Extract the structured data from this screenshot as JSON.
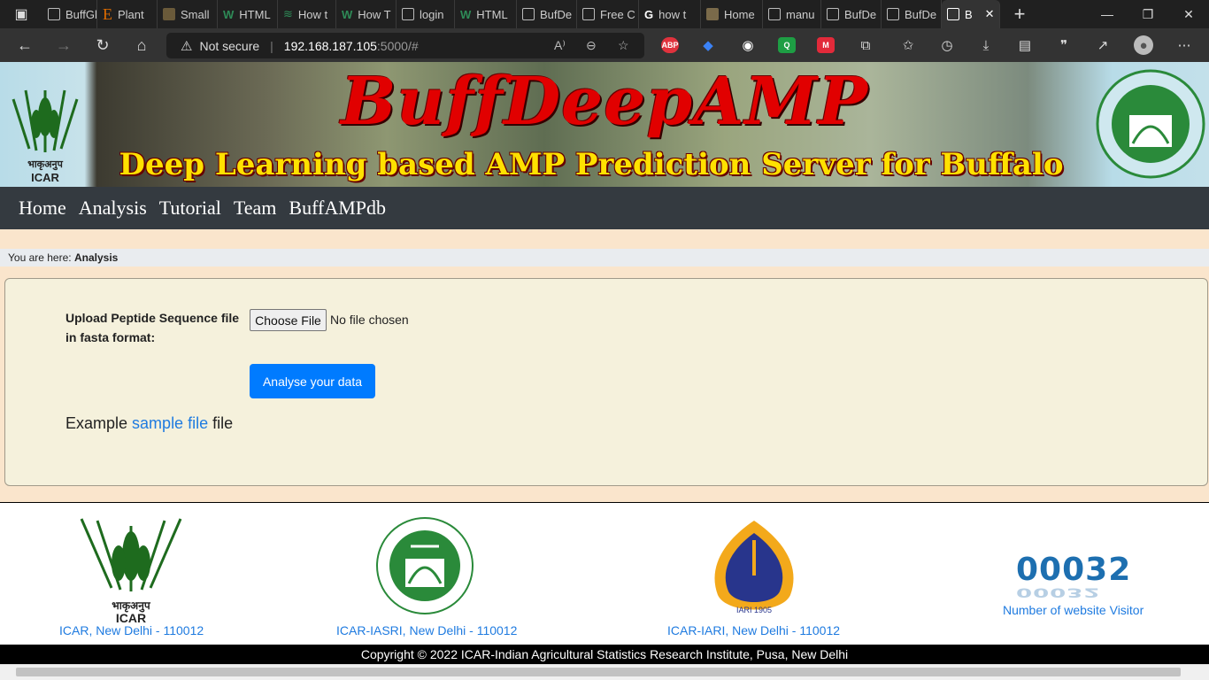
{
  "browser": {
    "tabs": [
      {
        "label": "BuffGl"
      },
      {
        "label": "Plant"
      },
      {
        "label": "Small"
      },
      {
        "label": "HTML"
      },
      {
        "label": "How t"
      },
      {
        "label": "How T"
      },
      {
        "label": "login"
      },
      {
        "label": "HTML"
      },
      {
        "label": "BufDe"
      },
      {
        "label": "Free C"
      },
      {
        "label": "how t"
      },
      {
        "label": "Home"
      },
      {
        "label": "manu"
      },
      {
        "label": "BufDe"
      },
      {
        "label": "BufDe"
      },
      {
        "label": "B"
      }
    ],
    "security_label": "Not secure",
    "url_host": "192.168.187.105",
    "url_path": ":5000/#",
    "extensions": [
      {
        "name": "abp",
        "label": "ABP",
        "color": "#e0323d"
      },
      {
        "name": "q",
        "label": "Q",
        "color": "#1e9e44"
      },
      {
        "name": "m",
        "label": "M",
        "color": "#e22a3a"
      }
    ]
  },
  "banner": {
    "title": "BuffDeepAMP",
    "subtitle": "Deep Learning based AMP Prediction Server for Buffalo",
    "left_logo_text_1": "भाकृअनुप",
    "left_logo_text_2": "ICAR"
  },
  "nav": {
    "items": [
      "Home",
      "Analysis",
      "Tutorial",
      "Team",
      "BuffAMPdb"
    ]
  },
  "breadcrumb": {
    "prefix": "You are here:",
    "current": "Analysis"
  },
  "form": {
    "upload_label": "Upload Peptide Sequence file in fasta format:",
    "choose_file_label": "Choose File",
    "file_status": "No file chosen",
    "submit_label": "Analyse your data",
    "example_prefix": "Example",
    "example_link": "sample file",
    "example_suffix": "file"
  },
  "footer": {
    "links": [
      "ICAR, New Delhi - 110012",
      "ICAR-IASRI, New Delhi - 110012",
      "ICAR-IARI, New Delhi - 110012"
    ],
    "icar_logo_text_1": "भाकृअनुप",
    "icar_logo_text_2": "ICAR",
    "iari_year": "IARI 1905",
    "visitor_count": "00032",
    "visitor_label": "Number of website Visitor",
    "copyright": "Copyright © 2022 ICAR-Indian Agricultural Statistics Research Institute, Pusa, New Delhi"
  }
}
